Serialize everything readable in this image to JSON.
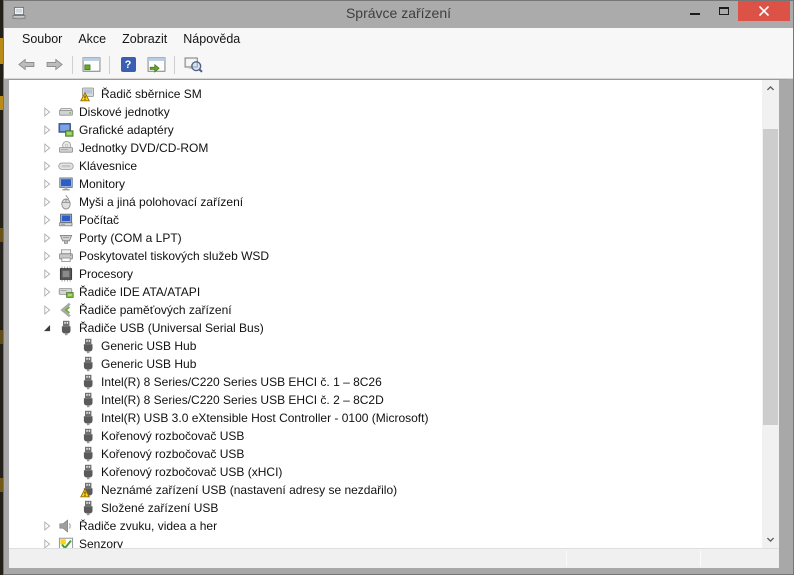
{
  "window": {
    "title": "Správce zařízení"
  },
  "menu": {
    "items": [
      {
        "id": "soubor",
        "label": "Soubor"
      },
      {
        "id": "akce",
        "label": "Akce"
      },
      {
        "id": "zobrazit",
        "label": "Zobrazit"
      },
      {
        "id": "napoveda",
        "label": "Nápověda"
      }
    ]
  },
  "toolbar": {
    "buttons": [
      {
        "id": "back",
        "icon": "arrow-left",
        "enabled": false
      },
      {
        "id": "forward",
        "icon": "arrow-right",
        "enabled": false
      },
      {
        "type": "separator"
      },
      {
        "id": "show-console-tree",
        "icon": "console-tree-window",
        "enabled": true
      },
      {
        "type": "separator"
      },
      {
        "id": "help",
        "icon": "help-question",
        "enabled": true
      },
      {
        "id": "properties",
        "icon": "properties-window",
        "enabled": true
      },
      {
        "type": "separator"
      },
      {
        "id": "scan-hardware-changes",
        "icon": "scan-magnifier",
        "enabled": true
      }
    ]
  },
  "tree": {
    "items": [
      {
        "label": "Řadič sběrnice SM",
        "level": 2,
        "state": "none",
        "icon": "smbus-device-warning"
      },
      {
        "label": "Diskové jednotky",
        "level": 1,
        "state": "collapsed",
        "icon": "disk-drives"
      },
      {
        "label": "Grafické adaptéry",
        "level": 1,
        "state": "collapsed",
        "icon": "display-adapters"
      },
      {
        "label": "Jednotky DVD/CD-ROM",
        "level": 1,
        "state": "collapsed",
        "icon": "dvd-drives"
      },
      {
        "label": "Klávesnice",
        "level": 1,
        "state": "collapsed",
        "icon": "keyboards"
      },
      {
        "label": "Monitory",
        "level": 1,
        "state": "collapsed",
        "icon": "monitors"
      },
      {
        "label": "Myši a jiná polohovací zařízení",
        "level": 1,
        "state": "collapsed",
        "icon": "mice"
      },
      {
        "label": "Počítač",
        "level": 1,
        "state": "collapsed",
        "icon": "computer"
      },
      {
        "label": "Porty (COM a LPT)",
        "level": 1,
        "state": "collapsed",
        "icon": "ports"
      },
      {
        "label": "Poskytovatel tiskových služeb WSD",
        "level": 1,
        "state": "collapsed",
        "icon": "print-services"
      },
      {
        "label": "Procesory",
        "level": 1,
        "state": "collapsed",
        "icon": "processors"
      },
      {
        "label": "Řadiče IDE ATA/ATAPI",
        "level": 1,
        "state": "collapsed",
        "icon": "ide-controllers"
      },
      {
        "label": "Řadiče paměťových zařízení",
        "level": 1,
        "state": "collapsed",
        "icon": "storage-controllers"
      },
      {
        "label": "Řadiče USB (Universal Serial Bus)",
        "level": 1,
        "state": "expanded",
        "icon": "usb-controller"
      },
      {
        "label": "Generic USB Hub",
        "level": 2,
        "state": "none",
        "icon": "usb-device"
      },
      {
        "label": "Generic USB Hub",
        "level": 2,
        "state": "none",
        "icon": "usb-device"
      },
      {
        "label": "Intel(R) 8 Series/C220 Series USB EHCI č. 1 – 8C26",
        "level": 2,
        "state": "none",
        "icon": "usb-device"
      },
      {
        "label": "Intel(R) 8 Series/C220 Series USB EHCI č. 2 – 8C2D",
        "level": 2,
        "state": "none",
        "icon": "usb-device"
      },
      {
        "label": "Intel(R) USB 3.0 eXtensible Host Controller - 0100 (Microsoft)",
        "level": 2,
        "state": "none",
        "icon": "usb-device"
      },
      {
        "label": "Kořenový rozbočovač USB",
        "level": 2,
        "state": "none",
        "icon": "usb-device"
      },
      {
        "label": "Kořenový rozbočovač USB",
        "level": 2,
        "state": "none",
        "icon": "usb-device"
      },
      {
        "label": "Kořenový rozbočovač USB (xHCI)",
        "level": 2,
        "state": "none",
        "icon": "usb-device"
      },
      {
        "label": "Neznámé zařízení USB (nastavení adresy se nezdařilo)",
        "level": 2,
        "state": "none",
        "icon": "usb-device-warning"
      },
      {
        "label": "Složené zařízení USB",
        "level": 2,
        "state": "none",
        "icon": "usb-device"
      },
      {
        "label": "Řadiče zvuku, videa a her",
        "level": 1,
        "state": "collapsed",
        "icon": "audio-controllers"
      },
      {
        "label": "Senzory",
        "level": 1,
        "state": "collapsed",
        "icon": "sensors"
      }
    ]
  },
  "colors": {
    "titlebar": "#ababab",
    "close_button": "#dc5247",
    "warning": "#ffd216",
    "window_chrome": "#a8a8a8"
  }
}
